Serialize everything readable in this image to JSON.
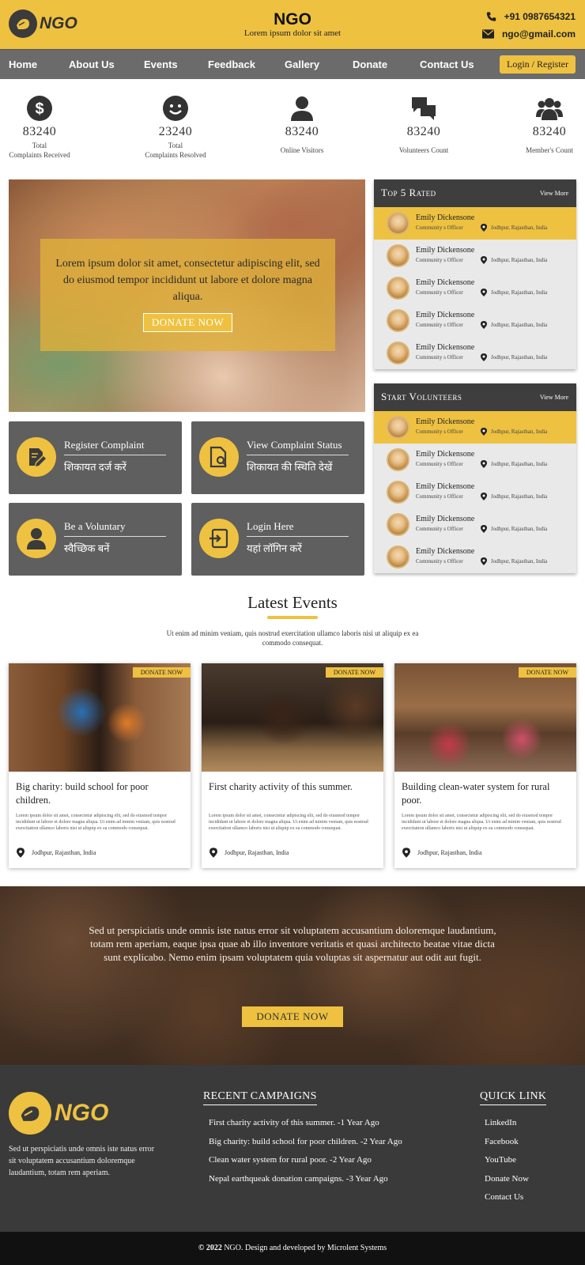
{
  "header": {
    "logo_text": "NGO",
    "title": "NGO",
    "tagline": "Lorem ipsum dolor sit amet",
    "phone": "+91 0987654321",
    "email": "ngo@gmail.com"
  },
  "nav": {
    "items": [
      "Home",
      "About Us",
      "Events",
      "Feedback",
      "Gallery",
      "Donate",
      "Contact Us"
    ],
    "login_label": "Login / Register"
  },
  "stats": [
    {
      "value": "83240",
      "label_1": "Total",
      "label_2": "Complaints Received",
      "icon": "dollar-icon"
    },
    {
      "value": "23240",
      "label_1": "Total",
      "label_2": "Complaints Resolved",
      "icon": "smile-icon"
    },
    {
      "value": "83240",
      "label_1": "",
      "label_2": "Online Visitors",
      "icon": "user-icon"
    },
    {
      "value": "83240",
      "label_1": "",
      "label_2": "Volunteers Count",
      "icon": "chat-icon"
    },
    {
      "value": "83240",
      "label_1": "",
      "label_2": "Member's Count",
      "icon": "group-icon"
    }
  ],
  "hero": {
    "text": "Lorem ipsum dolor sit amet, consectetur adipiscing elit, sed do eiusmod tempor incididunt ut labore et dolore magna aliqua.",
    "button": "DONATE NOW"
  },
  "actions": [
    {
      "title": "Register Complaint",
      "hindi": "शिकायत दर्ज करें",
      "icon": "edit-icon"
    },
    {
      "title": "View Complaint Status",
      "hindi": "शिकायत की स्थिति देखें",
      "icon": "file-search-icon"
    },
    {
      "title": "Be a Voluntary",
      "hindi": "स्वैच्छिक बनें",
      "icon": "user-icon"
    },
    {
      "title": "Login Here",
      "hindi": "यहां लॉगिन करें",
      "icon": "login-icon"
    }
  ],
  "top_rated": {
    "title": "Top 5 Rated",
    "more": "View More",
    "people": [
      {
        "name": "Emily Dickensone",
        "role": "Community s Officer",
        "location": "Jodhpur, Rajasthan, India"
      },
      {
        "name": "Emily Dickensone",
        "role": "Community s Officer",
        "location": "Jodhpur, Rajasthan, India"
      },
      {
        "name": "Emily Dickensone",
        "role": "Community s Officer",
        "location": "Jodhpur, Rajasthan, India"
      },
      {
        "name": "Emily Dickensone",
        "role": "Community s Officer",
        "location": "Jodhpur, Rajasthan, India"
      },
      {
        "name": "Emily Dickensone",
        "role": "Community s Officer",
        "location": "Jodhpur, Rajasthan, India"
      }
    ]
  },
  "star_volunteers": {
    "title": "Start Volunteers",
    "more": "View More",
    "people": [
      {
        "name": "Emily Dickensone",
        "role": "Community s Officer",
        "location": "Jodhpur, Rajasthan, India"
      },
      {
        "name": "Emily Dickensone",
        "role": "Community s Officer",
        "location": "Jodhpur, Rajasthan, India"
      },
      {
        "name": "Emily Dickensone",
        "role": "Community s Officer",
        "location": "Jodhpur, Rajasthan, India"
      },
      {
        "name": "Emily Dickensone",
        "role": "Community s Officer",
        "location": "Jodhpur, Rajasthan, India"
      },
      {
        "name": "Emily Dickensone",
        "role": "Community s Officer",
        "location": "Jodhpur, Rajasthan, India"
      }
    ]
  },
  "events": {
    "title": "Latest Events",
    "subtitle": "Ut enim ad minim veniam, quis nostrud exercitation ullamco laboris nisi ut aliquip ex ea commodo consequat.",
    "items": [
      {
        "tag": "DONATE NOW",
        "title": "Big charity: build school for poor children.",
        "desc": "Lorem ipsum dolor sit amet, consectetur adipiscing elit, sed do eiusmod tempor incididunt ut labore et dolore magna aliqua. Ut enim ad minim veniam, quis nostrud exercitation ullamco laboris nisi ut aliquip ex ea commodo consequat.",
        "location": "Jodhpur, Rajasthan, India"
      },
      {
        "tag": "DONATE NOW",
        "title": "First charity activity of this summer.",
        "desc": "Lorem ipsum dolor sit amet, consectetur adipiscing elit, sed do eiusmod tempor incididunt ut labore et dolore magna aliqua. Ut enim ad minim veniam, quis nostrud exercitation ullamco laboris nisi ut aliquip ex ea commodo consequat.",
        "location": "Jodhpur, Rajasthan, India"
      },
      {
        "tag": "DONATE NOW",
        "title": "Building clean-water system for rural poor.",
        "desc": "Lorem ipsum dolor sit amet, consectetur adipiscing elit, sed do eiusmod tempor incididunt ut labore et dolore magna aliqua. Ut enim ad minim veniam, quis nostrud exercitation ullamco laboris nisi ut aliquip ex ea commodo consequat.",
        "location": "Jodhpur, Rajasthan, India"
      }
    ]
  },
  "banner": {
    "text": "Sed ut perspiciatis unde omnis iste natus error sit voluptatem accusantium doloremque laudantium, totam rem aperiam, eaque ipsa quae ab illo inventore veritatis et quasi architecto beatae vitae dicta sunt explicabo. Nemo enim ipsam voluptatem quia voluptas sit aspernatur aut odit aut fugit.",
    "button": "DONATE NOW"
  },
  "footer": {
    "logo_text": "NGO",
    "description": "Sed ut perspiciatis unde omnis iste natus error sit voluptatem accusantium doloremque laudantium, totam rem aperiam.",
    "campaigns_title": "RECENT CAMPAIGNS",
    "campaigns": [
      "First charity activity of this summer. -1 Year Ago",
      "Big charity: build school for poor children. -2 Year Ago",
      "Clean water system for rural poor. -2 Year Ago",
      "Nepal earthqueak donation campaigns. -3 Year Ago"
    ],
    "quick_title": "QUICK LINK",
    "links": [
      "LinkedIn",
      "Facebook",
      "YouTube",
      "Donate Now",
      "Contact Us"
    ],
    "copyright_year": "© 2022",
    "copyright_rest": " NGO. Design and developed by Microlent Systems"
  },
  "colors": {
    "accent": "#eec141",
    "dark": "#3a3a3a",
    "nav": "#6b6b6b"
  }
}
